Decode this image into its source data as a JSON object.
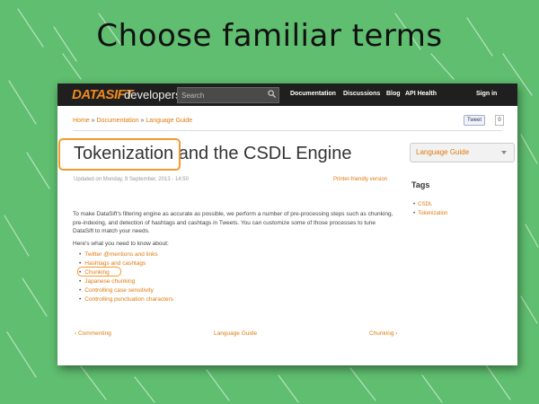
{
  "slide": {
    "headline": "Choose familiar terms",
    "background_color": "#5fbe6f",
    "highlight_color": "#f29a2e"
  },
  "header": {
    "logo": "DATASIFT",
    "subtitle": "developers",
    "search_placeholder": "Search",
    "nav": [
      "Documentation",
      "Discussions",
      "Blog",
      "API Health"
    ],
    "signin": "Sign in"
  },
  "breadcrumb": {
    "items": [
      "Home",
      "Documentation",
      "Language Guide"
    ],
    "separator": "»"
  },
  "tweet": {
    "label": "Tweet",
    "count": "0"
  },
  "page": {
    "title": "Tokenization and the CSDL Engine",
    "updated": "Updated on Monday, 9 September, 2013 - 14:50",
    "printer_link": "Printer-friendly version",
    "intro": "To make DataSift's filtering engine as accurate as possible, we perform a number of pre-processing steps such as chunking, pre-indexing, and detection of hashtags and cashtags in Tweets. You can customize some of those processes to tune DataSift to match your needs.",
    "here_is": "Here's what you need to know about:",
    "topics": [
      "Twitter @mentions and links",
      "Hashtags and cashtags",
      "Chunking",
      "Japanese chunking",
      "Controlling case sensitivity",
      "Controlling punctuation characters"
    ],
    "pager": {
      "prev": "‹ Commenting",
      "up": "Language Guide",
      "next": "Chunking ›"
    }
  },
  "sidebar": {
    "dropdown_label": "Language Guide",
    "tags_heading": "Tags",
    "tags": [
      "CSDL",
      "Tokenization"
    ]
  }
}
